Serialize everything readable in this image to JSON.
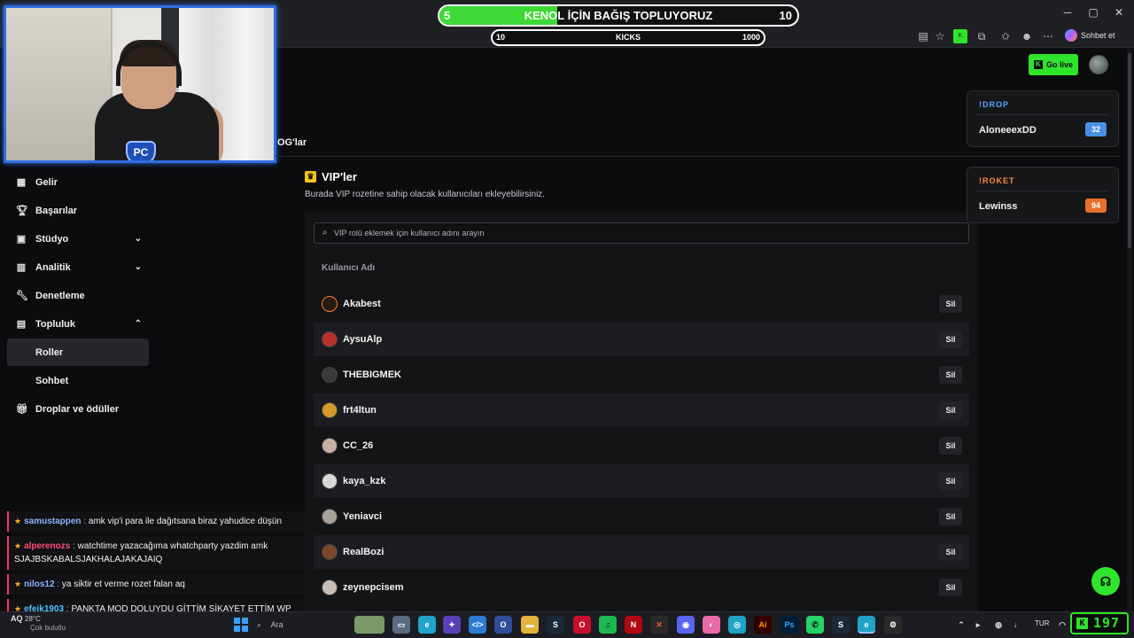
{
  "browser": {
    "chat_button_label": "Sohbet et",
    "window_controls": [
      "minimize-icon",
      "maximize-icon",
      "close-icon"
    ]
  },
  "donation": {
    "start": "5",
    "end": "10",
    "title": "KENOL İÇİN BAĞIŞ TOPLUYORUZ",
    "progress_fraction": 0.33
  },
  "kicks": {
    "start": "10",
    "title": "KICKS",
    "end": "1000"
  },
  "header": {
    "go_live_label": "Go live",
    "og_tab_label": "OG'lar"
  },
  "sidebar": {
    "items": [
      {
        "label": "Gelir",
        "icon": "chart-icon"
      },
      {
        "label": "Başarılar",
        "icon": "trophy-icon"
      },
      {
        "label": "Stüdyo",
        "icon": "studio-icon",
        "chevron": "down"
      },
      {
        "label": "Analitik",
        "icon": "analytics-icon",
        "chevron": "down"
      },
      {
        "label": "Denetleme",
        "icon": "wrench-icon"
      },
      {
        "label": "Topluluk",
        "icon": "community-icon",
        "chevron": "up"
      },
      {
        "label": "Roller",
        "active": true
      },
      {
        "label": "Sohbet"
      },
      {
        "label": "Droplar ve ödüller",
        "icon": "gift-icon"
      }
    ]
  },
  "chat": {
    "messages": [
      {
        "user": "samustappen",
        "text": "amk vip'i para ile dağıtsana biraz yahudice düşün",
        "color": "#8ab4ff"
      },
      {
        "user": "alperenozs",
        "text": "watchtime yazacağıma whatchparty yazdim amk SJAJBSKABALSJAKHALAJAKAJAIQ",
        "color": "#ff4f7b"
      },
      {
        "user": "nilos12",
        "text": "ya siktir et verme rozet falan aq",
        "color": "#8ab4ff"
      },
      {
        "user": "efejk1903",
        "text": "PANKTA MOD DOLUYDU GİTTİM ŞİKAYET ETTİM WP DEN",
        "color": "#4fc3ff"
      }
    ]
  },
  "vip": {
    "title": "VIP'ler",
    "description": "Burada VIP rozetine sahip olacak kullanıcıları ekleyebilirsiniz.",
    "search_placeholder": "VIP rolü eklemek için kullanıcı adını arayın",
    "column_header": "Kullanıcı Adı",
    "delete_label": "Sil",
    "users": [
      "Akabest",
      "AysuAlp",
      "THEBIGMEK",
      "frt4ltun",
      "CC_26",
      "kaya_kzk",
      "Yeniavci",
      "RealBozi",
      "zeynepcisem"
    ]
  },
  "widgets": [
    {
      "title": "!DROP",
      "user": "AloneeexDD",
      "count": "32",
      "title_color": "#5aa8ff",
      "badge_color": "#4a90e2"
    },
    {
      "title": "!ROKET",
      "user": "Lewinss",
      "count": "94",
      "title_color": "#ff8a3d",
      "badge_color": "#e8712a"
    }
  ],
  "taskbar": {
    "weather_label": "AQ",
    "temperature": "28°C",
    "weather_status": "Çok bulutlu",
    "search_label": "Ara",
    "language": "TUR",
    "kick_count": "197"
  }
}
